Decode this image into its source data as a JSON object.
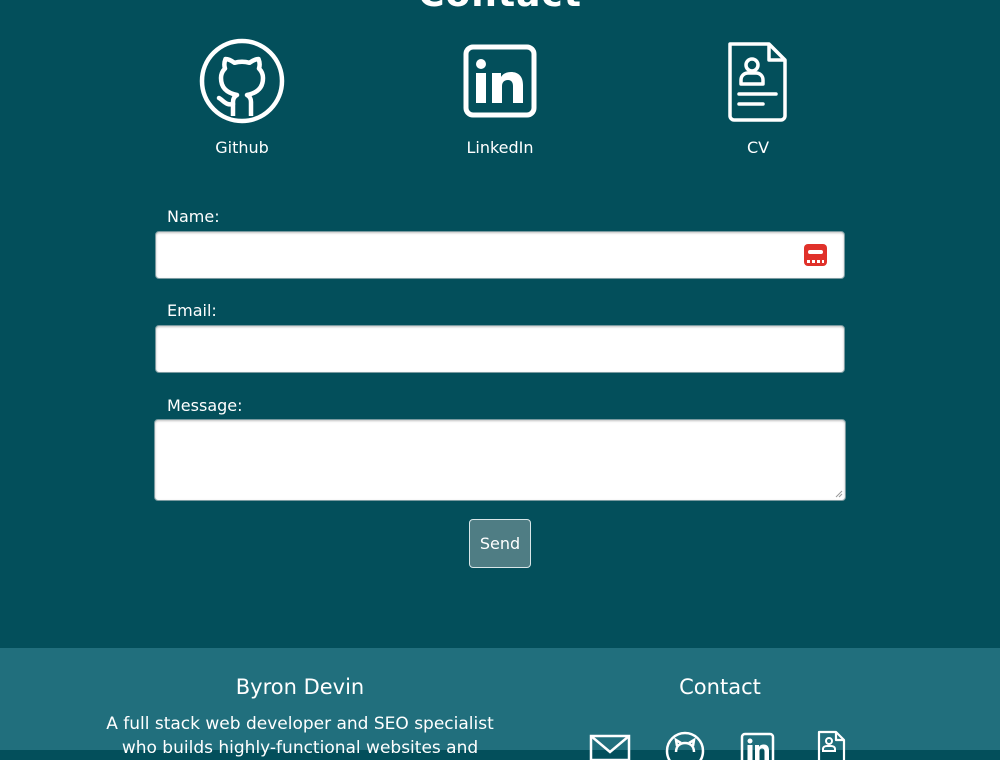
{
  "contact_section": {
    "title": "Contact",
    "links": [
      {
        "label": "Github",
        "icon": "github-icon"
      },
      {
        "label": "LinkedIn",
        "icon": "linkedin-icon"
      },
      {
        "label": "CV",
        "icon": "document-icon"
      }
    ]
  },
  "form": {
    "name_label": "Name:",
    "name_value": "",
    "email_label": "Email:",
    "email_value": "",
    "message_label": "Message:",
    "message_value": "",
    "send_label": "Send"
  },
  "footer": {
    "name": "Byron Devin",
    "bio": "A full stack web developer and SEO specialist who builds highly-functional websites and",
    "contact_title": "Contact",
    "icons": [
      "mail-icon",
      "github-icon",
      "linkedin-icon",
      "document-icon"
    ]
  },
  "colors": {
    "background": "#034f5b",
    "footer_background": "#216f7d",
    "send_button": "#4f7d84",
    "autofill_icon": "#e0312a"
  }
}
